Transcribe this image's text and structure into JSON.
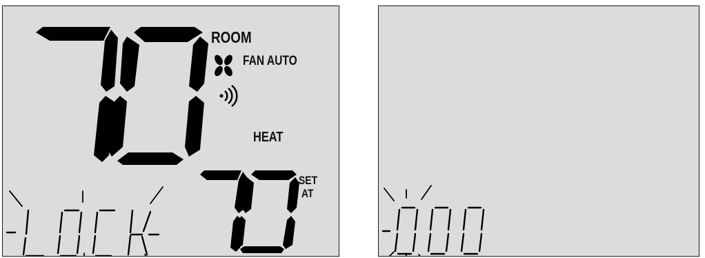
{
  "left_display": {
    "room_temperature": "70",
    "room_label": "ROOM",
    "fan_label": "FAN AUTO",
    "fan_icon": "fan-icon",
    "wireless_icon": "wireless-signal-icon",
    "mode_label": "HEAT",
    "set_temperature": "70",
    "set_label_line1": "SET",
    "set_label_line2": "AT",
    "message": "LOCK",
    "message_state": "flashing"
  },
  "right_display": {
    "code": "000",
    "code_state": "flashing"
  }
}
